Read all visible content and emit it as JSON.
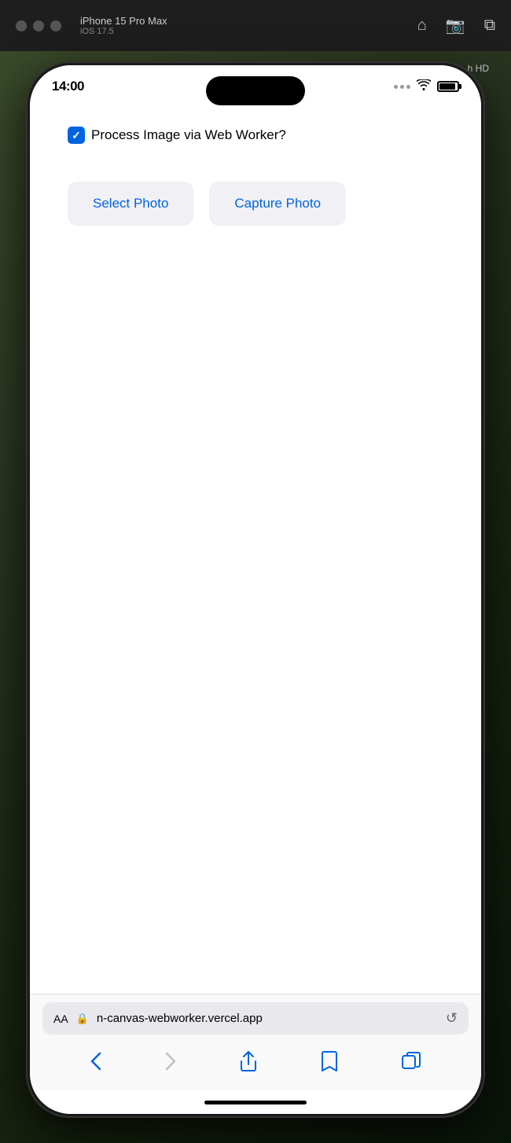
{
  "desktop_bar": {
    "traffic_lights": [
      "red",
      "yellow",
      "green"
    ],
    "title": "iPhone 15 Pro Max",
    "subtitle": "iOS 17.5",
    "icons": [
      "home-icon",
      "camera-icon",
      "screen-icon"
    ]
  },
  "hd_badge": "h HD",
  "status_bar": {
    "time": "14:00",
    "wifi": "wifi",
    "battery": "battery"
  },
  "main": {
    "checkbox_label": "Process Image via Web Worker?",
    "checkbox_checked": true,
    "select_photo_label": "Select Photo",
    "capture_photo_label": "Capture Photo"
  },
  "browser_bar": {
    "aa_label": "AA",
    "lock_icon": "🔒",
    "url": "n-canvas-webworker.vercel.app",
    "reload_icon": "↺"
  },
  "bottom_nav": {
    "back_label": "‹",
    "forward_label": "›",
    "share_label": "share",
    "bookmarks_label": "bookmarks",
    "tabs_label": "tabs"
  }
}
